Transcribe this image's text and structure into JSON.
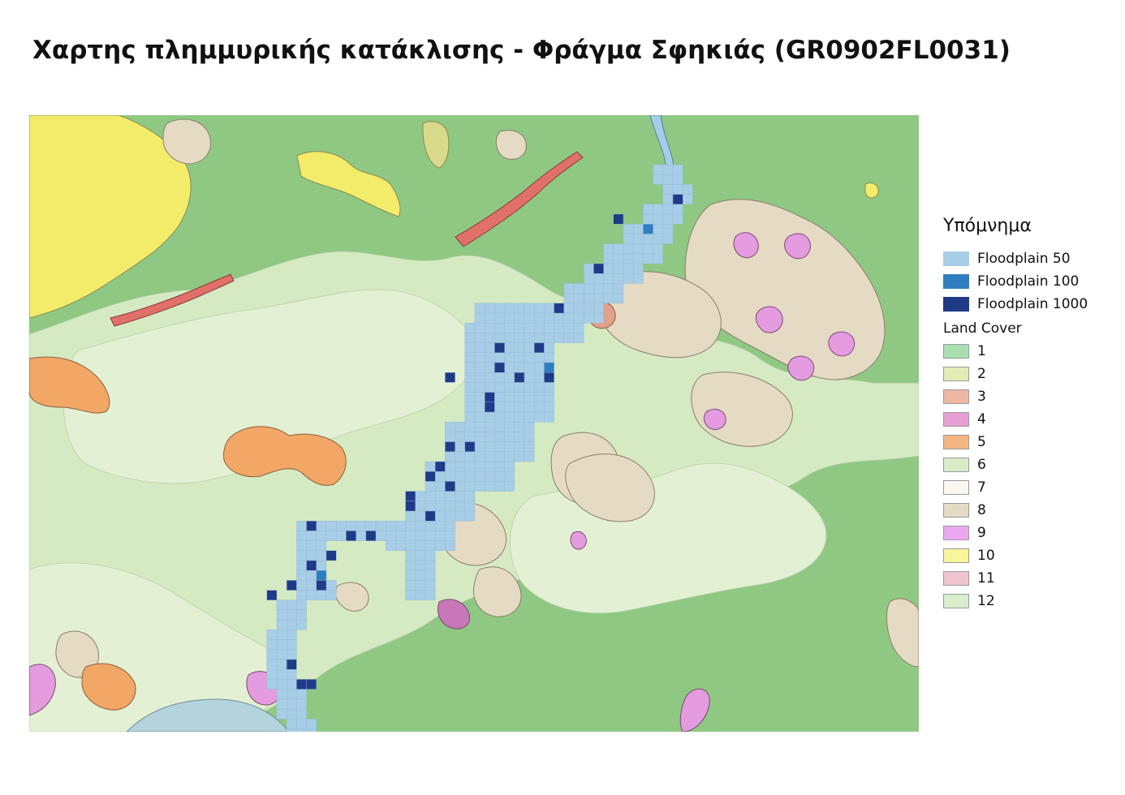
{
  "title": "Χαρτης πλημμυρικής κατάκλισης - Φράγμα Σφηκιάς (GR0902FL0031)",
  "legend": {
    "title": "Υπόμνημα",
    "floodplains": [
      {
        "label": "Floodplain 50",
        "color": "#a8cde6"
      },
      {
        "label": "Floodplain 100",
        "color": "#2f7fc0"
      },
      {
        "label": "Floodplain 1000",
        "color": "#1f3a86"
      }
    ],
    "land_cover_title": "Land Cover",
    "land_cover": [
      {
        "label": "1",
        "color": "#a8e0b0"
      },
      {
        "label": "2",
        "color": "#e2ecb4"
      },
      {
        "label": "3",
        "color": "#eeb7a2"
      },
      {
        "label": "4",
        "color": "#e8a0d4"
      },
      {
        "label": "5",
        "color": "#f5b583"
      },
      {
        "label": "6",
        "color": "#d8ecc8"
      },
      {
        "label": "7",
        "color": "#fbf7f0"
      },
      {
        "label": "8",
        "color": "#e5dbc4"
      },
      {
        "label": "9",
        "color": "#eaa8f0"
      },
      {
        "label": "10",
        "color": "#f8f59a"
      },
      {
        "label": "11",
        "color": "#f0c4cc"
      },
      {
        "label": "12",
        "color": "#d8eecc"
      }
    ]
  },
  "map": {
    "base_color": "#8fc883",
    "cell_color_50": "#a8cde6",
    "cell_color_100": "#2f7fc0",
    "cell_color_1000": "#1f3a86"
  }
}
